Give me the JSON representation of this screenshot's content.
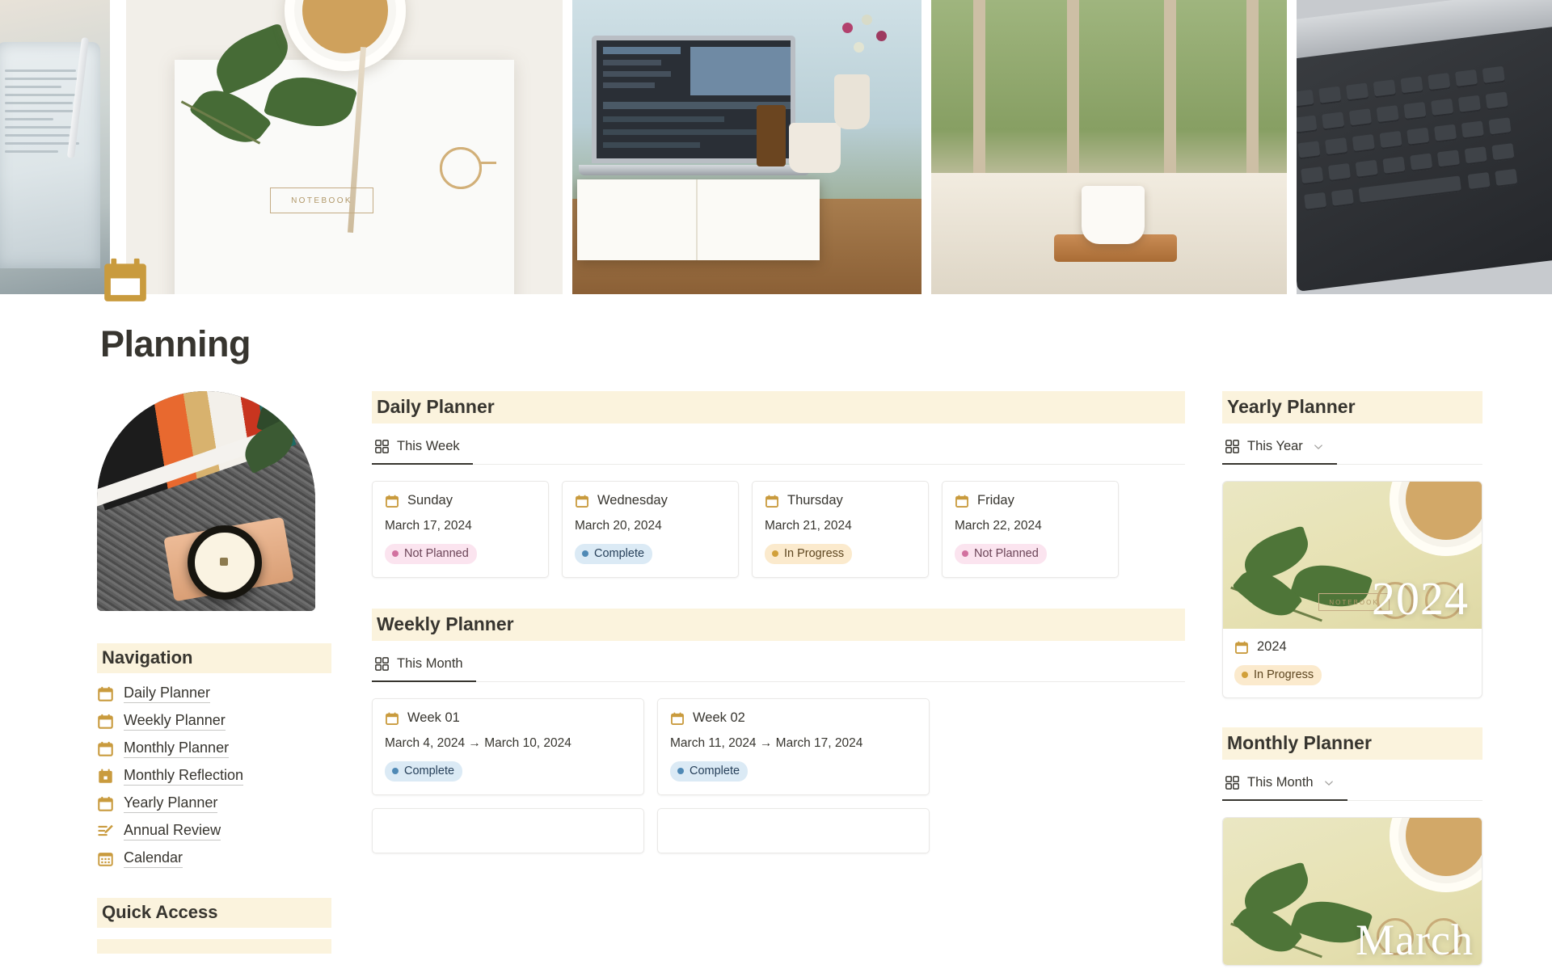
{
  "page": {
    "title": "Planning",
    "icon": "calendar-icon"
  },
  "cover": {
    "name": "cover-banner",
    "photos": [
      "tablet-with-stylus",
      "coffee-notebook-glasses",
      "laptop-open-book-cafe",
      "coffee-on-linen-by-window",
      "laptop-keyboard"
    ],
    "notebook_label": "NOTEBOOK"
  },
  "sidebar": {
    "photo": "magazine-candle-rug",
    "navigation": {
      "heading": "Navigation",
      "items": [
        {
          "label": "Daily Planner",
          "icon": "calendar-icon"
        },
        {
          "label": "Weekly Planner",
          "icon": "calendar-icon"
        },
        {
          "label": "Monthly Planner",
          "icon": "calendar-icon"
        },
        {
          "label": "Monthly Reflection",
          "icon": "calendar-solid-icon"
        },
        {
          "label": "Yearly Planner",
          "icon": "calendar-icon"
        },
        {
          "label": "Annual Review",
          "icon": "list-pencil-icon"
        },
        {
          "label": "Calendar",
          "icon": "calendar-grid-icon"
        }
      ]
    },
    "quick_access": {
      "heading": "Quick Access"
    }
  },
  "main": {
    "daily_planner": {
      "heading": "Daily Planner",
      "tab": {
        "label": "This Week",
        "icon": "gallery-view-icon",
        "active": true
      },
      "cards": [
        {
          "icon": "calendar-icon",
          "title": "Sunday",
          "date": "March 17, 2024",
          "status": "Not Planned",
          "status_key": "notplanned"
        },
        {
          "icon": "calendar-icon",
          "title": "Wednesday",
          "date": "March 20, 2024",
          "status": "Complete",
          "status_key": "complete"
        },
        {
          "icon": "calendar-icon",
          "title": "Thursday",
          "date": "March 21, 2024",
          "status": "In Progress",
          "status_key": "inprogress"
        },
        {
          "icon": "calendar-icon",
          "title": "Friday",
          "date": "March 22, 2024",
          "status": "Not Planned",
          "status_key": "notplanned"
        }
      ]
    },
    "weekly_planner": {
      "heading": "Weekly Planner",
      "tab": {
        "label": "This Month",
        "icon": "gallery-view-icon",
        "active": true
      },
      "cards": [
        {
          "icon": "calendar-icon",
          "title": "Week 01",
          "date": "March 4, 2024 → March 10, 2024",
          "status": "Complete",
          "status_key": "complete"
        },
        {
          "icon": "calendar-icon",
          "title": "Week 02",
          "date": "March 11, 2024 → March 17, 2024",
          "status": "Complete",
          "status_key": "complete"
        }
      ]
    }
  },
  "right": {
    "yearly_planner": {
      "heading": "Yearly Planner",
      "tab": {
        "label": "This Year",
        "icon": "gallery-view-icon",
        "chevron": "chevron-down-icon"
      },
      "card": {
        "cover_label": "2024",
        "icon": "calendar-icon",
        "title": "2024",
        "status": "In Progress",
        "status_key": "inprogress",
        "cover_notebook_label": "NOTEBOOK"
      }
    },
    "monthly_planner": {
      "heading": "Monthly Planner",
      "tab": {
        "label": "This Month",
        "icon": "gallery-view-icon",
        "chevron": "chevron-down-icon"
      },
      "card": {
        "cover_label": "March"
      }
    }
  },
  "colors": {
    "accent_gold": "#c99b3e",
    "section_header_bg": "#fbf3dd",
    "text": "#37352f",
    "status_not_planned": "#d2719f",
    "status_complete": "#4f89b5",
    "status_in_progress": "#d1a03a"
  }
}
